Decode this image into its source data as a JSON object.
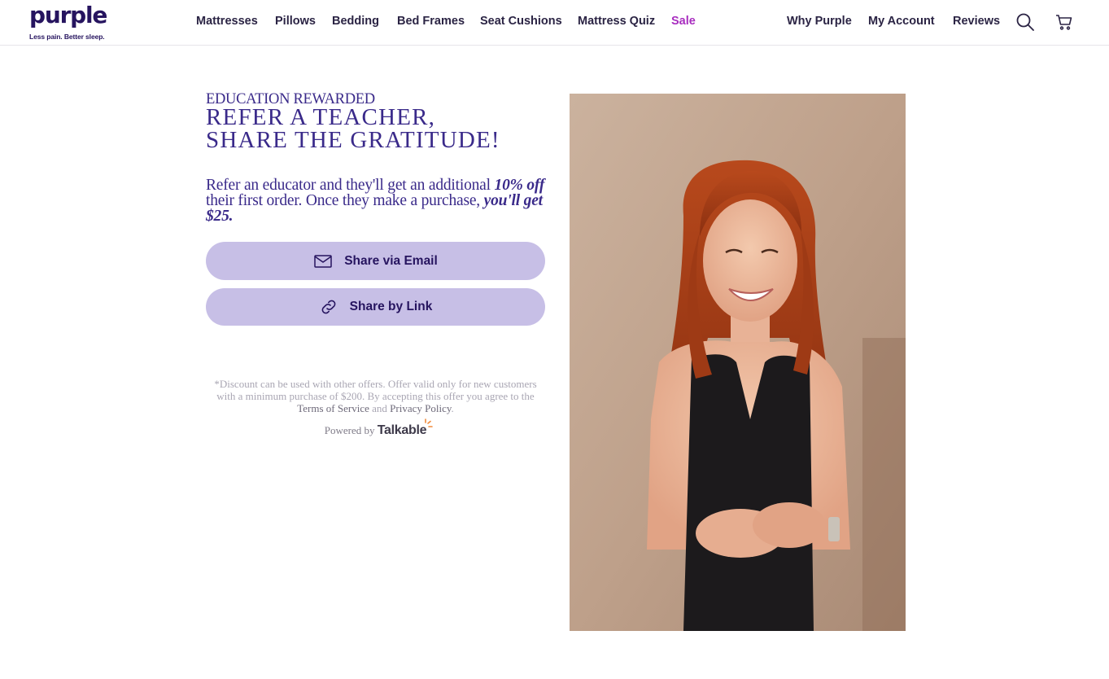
{
  "header": {
    "logo": {
      "name": "purple",
      "tagline": "Less pain. Better sleep."
    },
    "nav_left": [
      {
        "label": "Mattresses"
      },
      {
        "label": "Pillows"
      },
      {
        "label": "Bedding"
      },
      {
        "label": "Bed Frames"
      },
      {
        "label": "Seat Cushions"
      },
      {
        "label": "Mattress Quiz"
      },
      {
        "label": "Sale"
      }
    ],
    "nav_right": [
      {
        "label": "Why Purple"
      },
      {
        "label": "My Account"
      },
      {
        "label": "Reviews"
      }
    ],
    "icons": {
      "search": "search-icon",
      "cart": "cart-icon"
    },
    "colors": {
      "brand": "#26145f",
      "sale": "#a82dbf"
    }
  },
  "referral": {
    "eyebrow": "EDUCATION REWARDED",
    "headline_line1": "REFER A TEACHER,",
    "headline_line2": "SHARE THE GRATITUDE!",
    "offer_part1": "Refer an educator and they'll get an additional",
    "offer_discount": "10% off",
    "offer_part2": "their first order. Once they make a purchase,",
    "offer_reward_prefix": "you'll get",
    "offer_reward_amount": "$25."
  },
  "actions": {
    "email_label": "Share via Email",
    "link_label": "Share by Link",
    "email_icon": "mail-icon",
    "link_icon": "link-icon",
    "button_color": "#c7bfe6"
  },
  "footer": {
    "disclaimer": "*Discount can be used with other offers. Offer valid only for new customers with a minimum purchase of $200. By accepting this offer you agree to the",
    "terms_label": "Terms of Service",
    "and_text": "and",
    "privacy_label": "Privacy Policy",
    "period": ".",
    "powered_by": "Powered by",
    "powered_brand": "Talkable"
  },
  "photo": {
    "subject": "smiling-educator-photo"
  }
}
